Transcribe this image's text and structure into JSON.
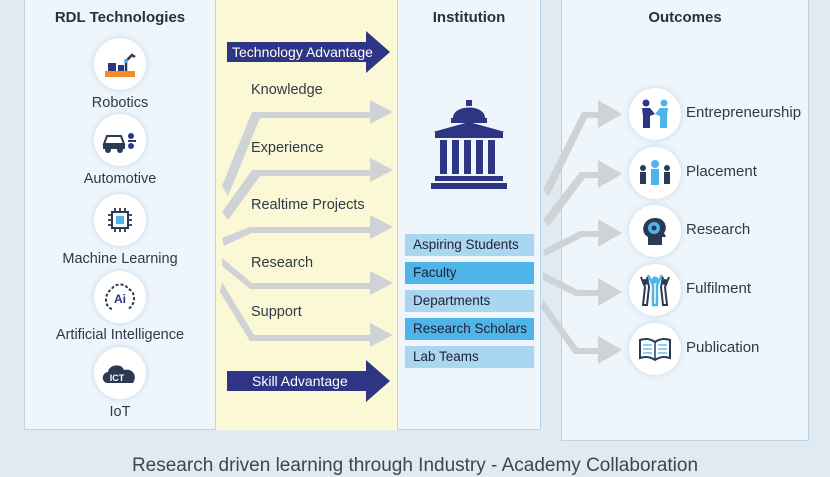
{
  "left_panel": {
    "title": "RDL Technologies",
    "items": [
      {
        "label": "Robotics",
        "icon": "robot-arm-icon"
      },
      {
        "label": "Automotive",
        "icon": "car-icon"
      },
      {
        "label": "Machine Learning",
        "icon": "chip-icon"
      },
      {
        "label": "Artificial Intelligence",
        "icon": "ai-brain-icon"
      },
      {
        "label": "IoT",
        "icon": "ict-cloud-icon"
      }
    ]
  },
  "flow": {
    "top_advantage": "Technology Advantage",
    "items": [
      "Knowledge",
      "Experience",
      "Realtime Projects",
      "Research",
      "Support"
    ],
    "bottom_advantage": "Skill Advantage"
  },
  "institution": {
    "title": "Institution",
    "icon": "institution-building-icon",
    "items": [
      "Aspiring Students",
      "Faculty",
      "Departments",
      "Research Scholars",
      "Lab Teams"
    ]
  },
  "outcomes": {
    "title": "Outcomes",
    "items": [
      {
        "label": "Entrepreneurship",
        "icon": "handshake-icon"
      },
      {
        "label": "Placement",
        "icon": "team-icon"
      },
      {
        "label": "Research",
        "icon": "head-gear-icon"
      },
      {
        "label": "Fulfilment",
        "icon": "celebrate-icon"
      },
      {
        "label": "Publication",
        "icon": "book-icon"
      }
    ]
  },
  "caption": "Research driven learning through Industry - Academy Collaboration",
  "colors": {
    "panel": "#eef5fb",
    "band": "#fbf8d6",
    "advantage_arrow": "#2d3584",
    "flow_arrow": "#cfd3d6",
    "inst_light": "#a9d7f2",
    "inst_dark": "#4fb4e8",
    "building": "#2d3584"
  }
}
